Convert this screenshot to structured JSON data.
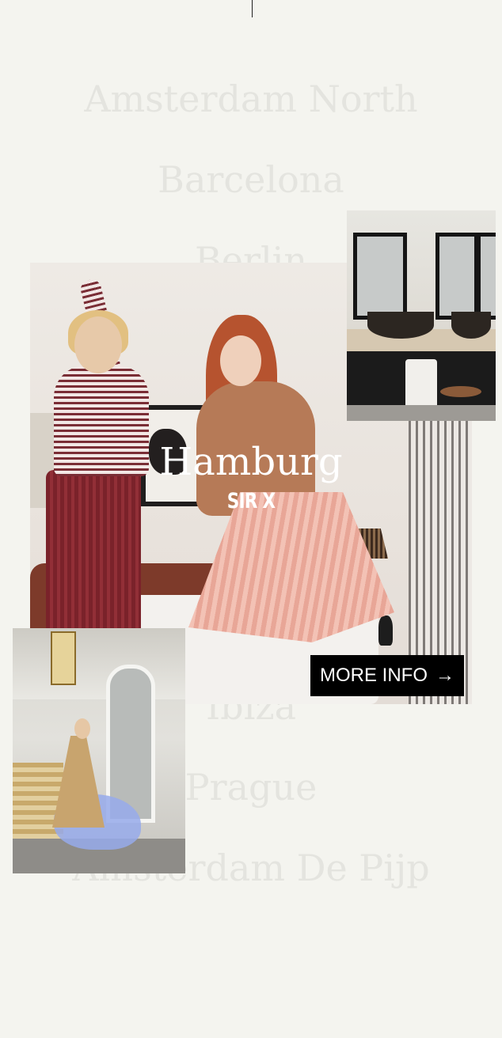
{
  "cities": [
    "Amsterdam North",
    "Barcelona",
    "Berlin",
    "Hamburg",
    "Ibiza",
    "Prague",
    "Amsterdam De Pijp"
  ],
  "featured": {
    "city": "Hamburg",
    "hotel": "SIR X",
    "cta_label": "MORE INFO",
    "cta_icon": "arrow-right-icon"
  },
  "colors": {
    "background": "#f4f4ef",
    "city_text_inactive": "#e4e4df",
    "cta_background": "#000000",
    "cta_text": "#ffffff"
  }
}
